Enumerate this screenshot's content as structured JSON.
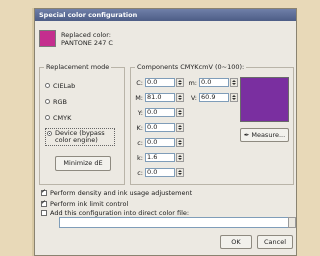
{
  "dialog": {
    "title": "Special color configuration",
    "replaced_color_label": "Replaced color:",
    "replaced_color_name": "PANTONE 247 C",
    "replaced_color_hex": "#c42e8e"
  },
  "replacement_mode": {
    "title": "Replacement mode",
    "options": [
      "CIELab",
      "RGB",
      "CMYK",
      "Device (bypass color engine)"
    ],
    "selected_index": 3,
    "minimize_label": "Minimize dE"
  },
  "components": {
    "title": "Components CMYKcmV (0~100):",
    "rows_left": [
      {
        "letter": "C:",
        "value": "0.0"
      },
      {
        "letter": "M:",
        "value": "81.0"
      },
      {
        "letter": "Y:",
        "value": "0.0"
      },
      {
        "letter": "K:",
        "value": "0.0"
      },
      {
        "letter": "c:",
        "value": "0.0"
      },
      {
        "letter": "k:",
        "value": "1.6"
      },
      {
        "letter": "c:",
        "value": "0.0"
      }
    ],
    "rows_right": [
      {
        "letter": "m:",
        "value": "0.0"
      },
      {
        "letter": "V:",
        "value": "60.9"
      }
    ],
    "preview_hex": "#7a2fa0",
    "measure_label": "Measure..."
  },
  "options": {
    "density_label": "Perform density and ink usage adjustement",
    "density_checked": true,
    "inklimit_label": "Perform ink limit control",
    "inklimit_checked": true,
    "addfile_label": "Add this configuration into direct color file:",
    "addfile_checked": false
  },
  "buttons": {
    "ok": "OK",
    "cancel": "Cancel"
  }
}
